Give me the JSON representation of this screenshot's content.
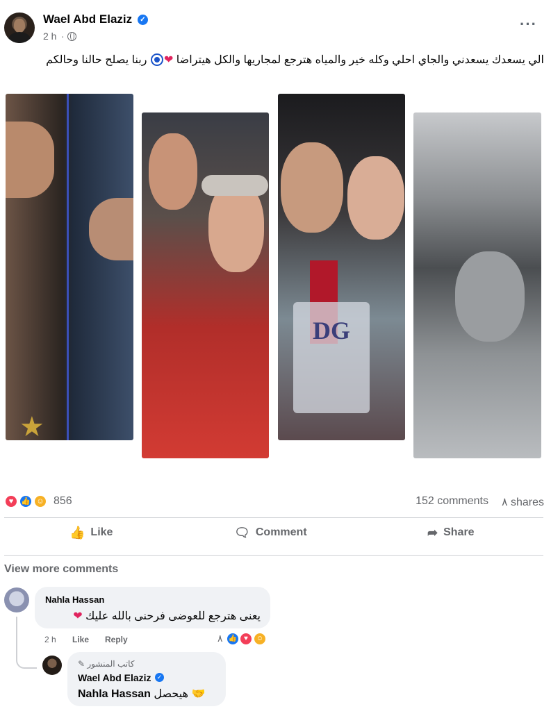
{
  "post": {
    "author": "Wael Abd Elaziz",
    "time": "2 h",
    "text": "الي يسعدك يسعدني والجاي احلي وكله خير والمياه هترجع لمجاريها والكل هيتراضا",
    "text_suffix": "ربنا يصلح حالنا وحالكم",
    "more_label": "···"
  },
  "photos": {
    "trophy_text": "DG"
  },
  "reactions": {
    "count": "856",
    "comments": "152 comments",
    "shares": "٨ shares"
  },
  "actions": {
    "like": "Like",
    "comment": "Comment",
    "share": "Share"
  },
  "comments": {
    "view_more": "View more comments",
    "first": {
      "author": "Nahla Hassan",
      "text": "يعنى هترجع للعوضى فرحنى بالله عليك",
      "time": "2 h",
      "like": "Like",
      "reply": "Reply",
      "reaction_count": "٨"
    },
    "reply": {
      "author_tag": "كاتب المنشور",
      "author": "Wael Abd Elaziz",
      "mention": "Nahla Hassan",
      "text": "هيحصل"
    }
  },
  "colors": {
    "accent": "#1877f2",
    "secondary_text": "#65676b",
    "bubble": "#f0f2f5"
  }
}
